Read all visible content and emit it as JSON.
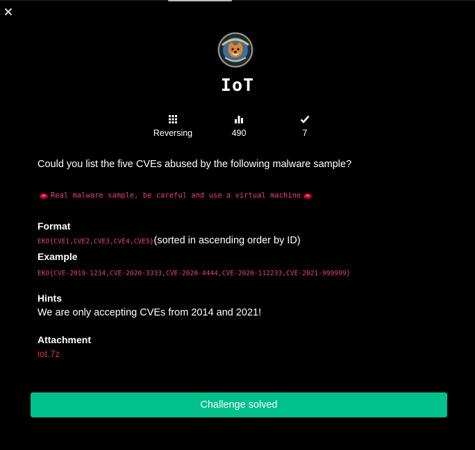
{
  "window": {
    "close_icon": "close-icon"
  },
  "challenge": {
    "title": "IoT",
    "logo_icon": "event-logo-dog-badge",
    "stats": [
      {
        "icon": "grid-icon",
        "value": "Reversing"
      },
      {
        "icon": "bar-chart-icon",
        "value": "490"
      },
      {
        "icon": "check-icon",
        "value": "7"
      }
    ],
    "description": "Could you list the five CVEs abused by the following malware sample?",
    "warning": "Real malware sample, be careful and use a virtual machine",
    "format_label": "Format",
    "format_code": "EKO{CVE1,CVE2,CVE3,CVE4,CVE5}",
    "format_note": "(sorted in ascending order by ID)",
    "example_label": "Example",
    "example_code": "EKO{CVE-2019-1234,CVE-2020-3333,CVE-2020-4444,CVE-2020-112233,CVE-2021-999999}",
    "hints_label": "Hints",
    "hint_text": "We are only accepting CVEs from 2014 and 2021!",
    "attachment_label": "Attachment",
    "attachment_file": "iot.7z",
    "solved_button": "Challenge solved"
  },
  "colors": {
    "background": "#000000",
    "accent_code": "#e8437a",
    "link": "#d6304f",
    "button": "#00c08b"
  }
}
